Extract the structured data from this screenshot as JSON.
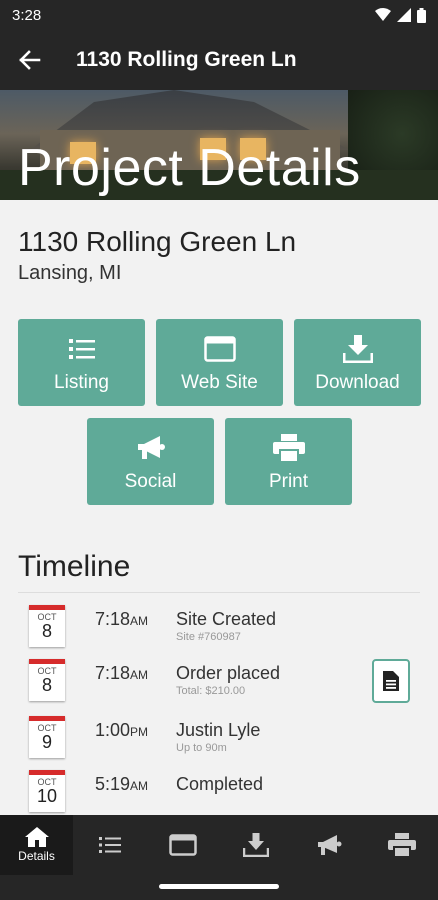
{
  "status_bar": {
    "time": "3:28"
  },
  "app_bar": {
    "title": "1130 Rolling Green Ln"
  },
  "hero": {
    "title": "Project Details"
  },
  "property": {
    "address": "1130 Rolling Green Ln",
    "city": "Lansing, MI"
  },
  "actions": [
    {
      "label": "Listing",
      "icon": "list-icon"
    },
    {
      "label": "Web Site",
      "icon": "browser-window-icon"
    },
    {
      "label": "Download",
      "icon": "download-icon"
    },
    {
      "label": "Social",
      "icon": "megaphone-icon"
    },
    {
      "label": "Print",
      "icon": "printer-icon"
    }
  ],
  "timeline": {
    "title": "Timeline",
    "events": [
      {
        "month": "OCT",
        "day": "8",
        "time": "7:18",
        "ampm": "AM",
        "event": "Site Created",
        "sub": "Site #760987"
      },
      {
        "month": "OCT",
        "day": "8",
        "time": "7:18",
        "ampm": "AM",
        "event": "Order placed",
        "sub": "Total: $210.00"
      },
      {
        "month": "OCT",
        "day": "9",
        "time": "1:00",
        "ampm": "PM",
        "event": "Justin Lyle",
        "sub": "Up to 90m"
      },
      {
        "month": "OCT",
        "day": "10",
        "time": "5:19",
        "ampm": "AM",
        "event": "Completed",
        "sub": ""
      }
    ]
  },
  "bottom_nav": {
    "details_label": "Details"
  },
  "colors": {
    "accent": "#5faa98",
    "bar": "#262626",
    "calendar_red": "#d62b2b"
  }
}
